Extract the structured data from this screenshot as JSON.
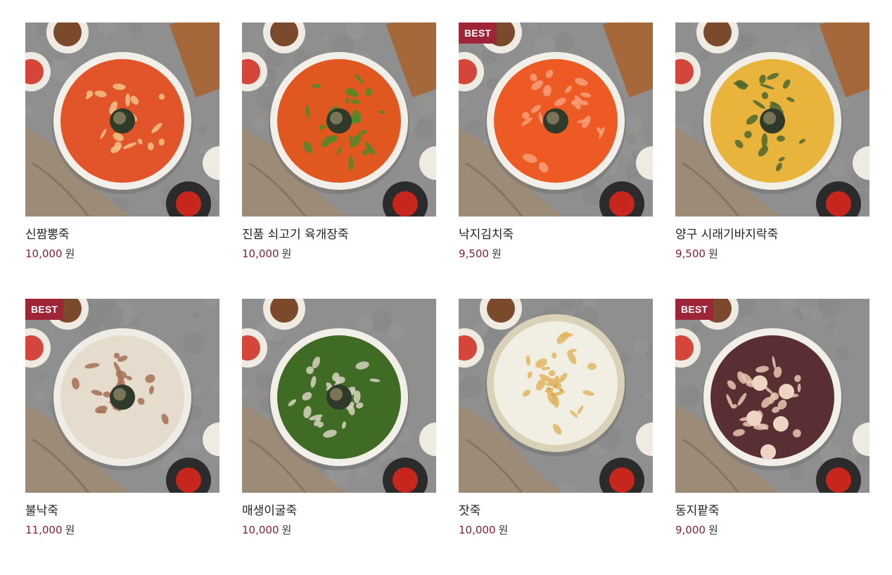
{
  "products": [
    {
      "name": "신짬뽕죽",
      "price": "10,000",
      "currency": "원",
      "badge": "",
      "image": "spicy-seafood-porridge",
      "colors": {
        "porridge": "#e2542a",
        "accent": "#f5c28a",
        "rim": "#f2efe8"
      }
    },
    {
      "name": "진품 쇠고기 육개장죽",
      "price": "10,000",
      "currency": "원",
      "badge": "",
      "image": "beef-yukgaejang-porridge",
      "colors": {
        "porridge": "#e0581f",
        "accent": "#4f8a2a",
        "rim": "#f2efe8"
      }
    },
    {
      "name": "낙지김치죽",
      "price": "9,500",
      "currency": "원",
      "badge": "BEST",
      "image": "octopus-kimchi-porridge",
      "colors": {
        "porridge": "#ee5a24",
        "accent": "#f7a07a",
        "rim": "#f2efe8"
      }
    },
    {
      "name": "양구 시래기바지락죽",
      "price": "9,500",
      "currency": "원",
      "badge": "",
      "image": "radish-greens-clam-porridge",
      "colors": {
        "porridge": "#e9b43c",
        "accent": "#4c6630",
        "rim": "#f2efe8"
      }
    },
    {
      "name": "불낙죽",
      "price": "11,000",
      "currency": "원",
      "badge": "BEST",
      "image": "bulgogi-octopus-porridge",
      "colors": {
        "porridge": "#e6dccd",
        "accent": "#a56f53",
        "rim": "#efece6"
      }
    },
    {
      "name": "매생이굴죽",
      "price": "10,000",
      "currency": "원",
      "badge": "",
      "image": "seaweed-oyster-porridge",
      "colors": {
        "porridge": "#3f6b25",
        "accent": "#d8d2c0",
        "rim": "#f2efe8"
      }
    },
    {
      "name": "잣죽",
      "price": "10,000",
      "currency": "원",
      "badge": "",
      "image": "pine-nut-porridge",
      "colors": {
        "porridge": "#f1efe4",
        "accent": "#e0b560",
        "rim": "#d9d2b8"
      }
    },
    {
      "name": "동지팥죽",
      "price": "9,000",
      "currency": "원",
      "badge": "BEST",
      "image": "red-bean-porridge",
      "colors": {
        "porridge": "#5a2f33",
        "accent": "#e9c6b0",
        "rim": "#f2efe8"
      }
    }
  ]
}
